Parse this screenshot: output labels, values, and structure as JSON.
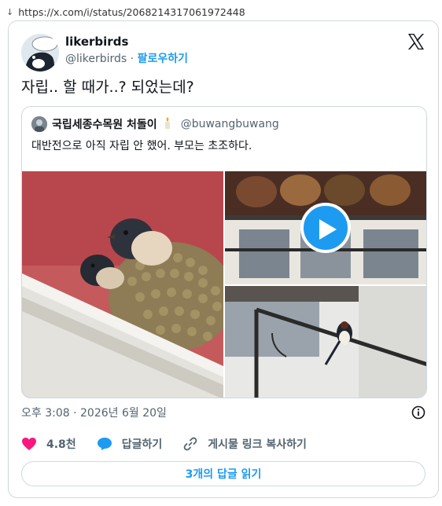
{
  "browser": {
    "url": "https://x.com/i/status/2068214317061972448"
  },
  "tweet": {
    "author_name": "likerbirds",
    "author_handle": "@likerbirds",
    "follow_label": "팔로우하기",
    "separator": " · ",
    "text": "자립.. 할 때가..? 되었는데?",
    "timestamp": "오후 3:08 · 2026년 6월 20일"
  },
  "quote": {
    "author_name": "국립세종수목원 처돌이",
    "author_handle": "@buwangbuwang",
    "text": "대반전으로 아직 자립 안 했어. 부모는 초조하다."
  },
  "actions": {
    "like_count": "4.8천",
    "reply_label": "답글하기",
    "share_label": "게시물 링크 복사하기"
  },
  "replies_button": "3개의 답글 읽기",
  "colors": {
    "accent": "#1d9bf0",
    "like": "#f91880",
    "text": "#0f1419",
    "muted": "#536471",
    "border": "#cfd9de"
  },
  "icons": [
    "down-arrow-icon",
    "x-logo-icon",
    "candle-emoji-icon",
    "play-icon",
    "info-icon",
    "heart-icon",
    "reply-bubble-icon",
    "link-icon"
  ]
}
